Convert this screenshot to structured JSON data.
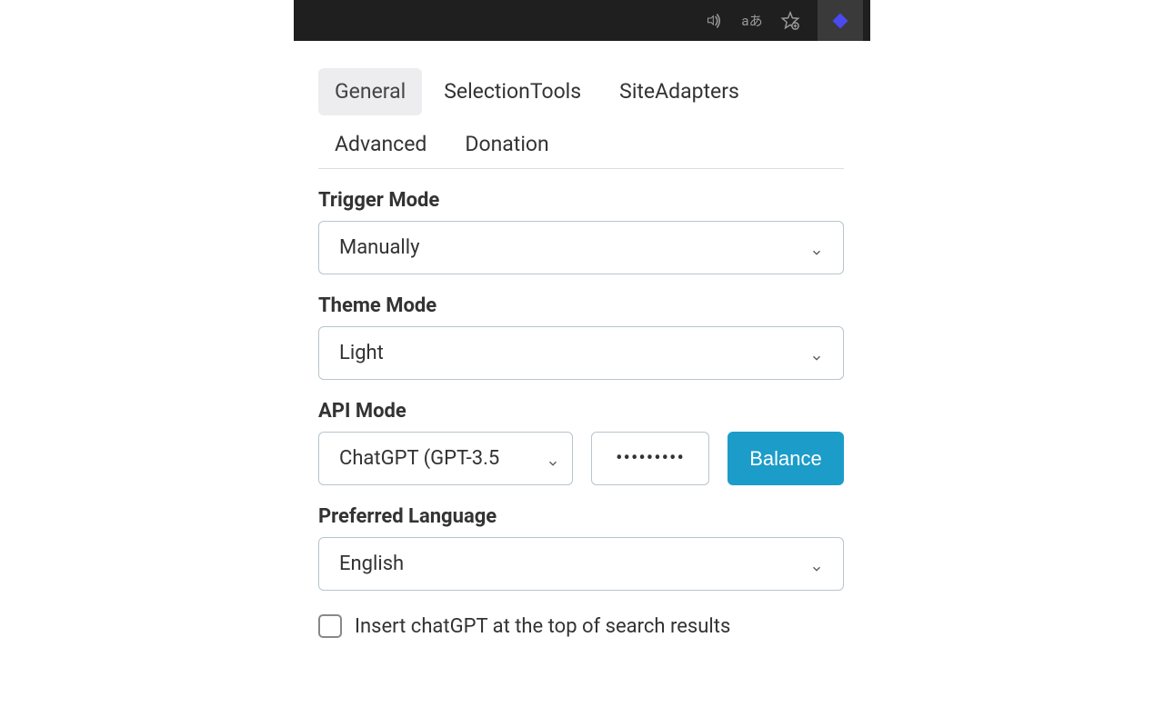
{
  "browser": {
    "icons": [
      "read-aloud",
      "translate",
      "favorites"
    ]
  },
  "tabs": {
    "items": [
      "General",
      "SelectionTools",
      "SiteAdapters",
      "Advanced",
      "Donation"
    ],
    "active_index": 0
  },
  "sections": {
    "trigger_mode": {
      "label": "Trigger Mode",
      "value": "Manually"
    },
    "theme_mode": {
      "label": "Theme Mode",
      "value": "Light"
    },
    "api_mode": {
      "label": "API Mode",
      "value": "ChatGPT (GPT-3.5",
      "api_key_mask": "•••••••••",
      "balance_label": "Balance"
    },
    "preferred_language": {
      "label": "Preferred Language",
      "value": "English"
    },
    "insert_top": {
      "label": "Insert chatGPT at the top of search results",
      "checked": false
    }
  },
  "colors": {
    "accent": "#1c9cc9",
    "tab_active_bg": "#ededf0",
    "border": "#b8c5cc"
  }
}
